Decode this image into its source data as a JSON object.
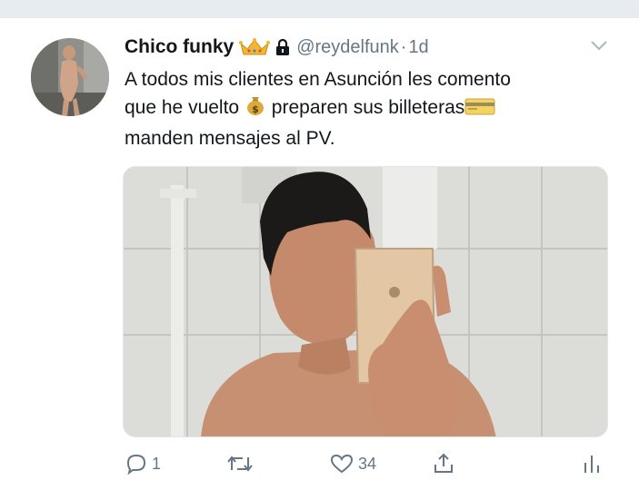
{
  "colors": {
    "text_primary": "#14171a",
    "text_secondary": "#657786",
    "background_strip": "#e6ecf0",
    "crown": "#f2b632"
  },
  "tweet": {
    "author": {
      "display_name": "Chico funky",
      "handle": "@reydelfunk",
      "separator": "·",
      "timestamp": "1d",
      "badges": [
        "crown-emoji",
        "lock-icon"
      ]
    },
    "text_lines": [
      "A todos mis clientes en Asunción les comento",
      "que he vuelto",
      "preparen sus billeteras",
      "manden mensajes al PV."
    ],
    "emojis": [
      "money-bag-emoji",
      "credit-card-emoji"
    ],
    "media": {
      "type": "photo"
    },
    "actions": {
      "reply_count": "1",
      "retweet_count": "",
      "like_count": "34"
    }
  }
}
